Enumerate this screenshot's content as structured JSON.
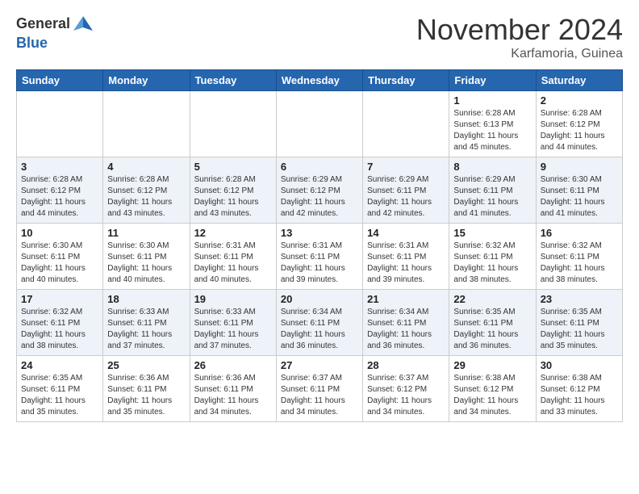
{
  "header": {
    "logo_general": "General",
    "logo_blue": "Blue",
    "month_title": "November 2024",
    "location": "Karfamoria, Guinea"
  },
  "days_of_week": [
    "Sunday",
    "Monday",
    "Tuesday",
    "Wednesday",
    "Thursday",
    "Friday",
    "Saturday"
  ],
  "weeks": [
    [
      {
        "day": "",
        "info": ""
      },
      {
        "day": "",
        "info": ""
      },
      {
        "day": "",
        "info": ""
      },
      {
        "day": "",
        "info": ""
      },
      {
        "day": "",
        "info": ""
      },
      {
        "day": "1",
        "info": "Sunrise: 6:28 AM\nSunset: 6:13 PM\nDaylight: 11 hours\nand 45 minutes."
      },
      {
        "day": "2",
        "info": "Sunrise: 6:28 AM\nSunset: 6:12 PM\nDaylight: 11 hours\nand 44 minutes."
      }
    ],
    [
      {
        "day": "3",
        "info": "Sunrise: 6:28 AM\nSunset: 6:12 PM\nDaylight: 11 hours\nand 44 minutes."
      },
      {
        "day": "4",
        "info": "Sunrise: 6:28 AM\nSunset: 6:12 PM\nDaylight: 11 hours\nand 43 minutes."
      },
      {
        "day": "5",
        "info": "Sunrise: 6:28 AM\nSunset: 6:12 PM\nDaylight: 11 hours\nand 43 minutes."
      },
      {
        "day": "6",
        "info": "Sunrise: 6:29 AM\nSunset: 6:12 PM\nDaylight: 11 hours\nand 42 minutes."
      },
      {
        "day": "7",
        "info": "Sunrise: 6:29 AM\nSunset: 6:11 PM\nDaylight: 11 hours\nand 42 minutes."
      },
      {
        "day": "8",
        "info": "Sunrise: 6:29 AM\nSunset: 6:11 PM\nDaylight: 11 hours\nand 41 minutes."
      },
      {
        "day": "9",
        "info": "Sunrise: 6:30 AM\nSunset: 6:11 PM\nDaylight: 11 hours\nand 41 minutes."
      }
    ],
    [
      {
        "day": "10",
        "info": "Sunrise: 6:30 AM\nSunset: 6:11 PM\nDaylight: 11 hours\nand 40 minutes."
      },
      {
        "day": "11",
        "info": "Sunrise: 6:30 AM\nSunset: 6:11 PM\nDaylight: 11 hours\nand 40 minutes."
      },
      {
        "day": "12",
        "info": "Sunrise: 6:31 AM\nSunset: 6:11 PM\nDaylight: 11 hours\nand 40 minutes."
      },
      {
        "day": "13",
        "info": "Sunrise: 6:31 AM\nSunset: 6:11 PM\nDaylight: 11 hours\nand 39 minutes."
      },
      {
        "day": "14",
        "info": "Sunrise: 6:31 AM\nSunset: 6:11 PM\nDaylight: 11 hours\nand 39 minutes."
      },
      {
        "day": "15",
        "info": "Sunrise: 6:32 AM\nSunset: 6:11 PM\nDaylight: 11 hours\nand 38 minutes."
      },
      {
        "day": "16",
        "info": "Sunrise: 6:32 AM\nSunset: 6:11 PM\nDaylight: 11 hours\nand 38 minutes."
      }
    ],
    [
      {
        "day": "17",
        "info": "Sunrise: 6:32 AM\nSunset: 6:11 PM\nDaylight: 11 hours\nand 38 minutes."
      },
      {
        "day": "18",
        "info": "Sunrise: 6:33 AM\nSunset: 6:11 PM\nDaylight: 11 hours\nand 37 minutes."
      },
      {
        "day": "19",
        "info": "Sunrise: 6:33 AM\nSunset: 6:11 PM\nDaylight: 11 hours\nand 37 minutes."
      },
      {
        "day": "20",
        "info": "Sunrise: 6:34 AM\nSunset: 6:11 PM\nDaylight: 11 hours\nand 36 minutes."
      },
      {
        "day": "21",
        "info": "Sunrise: 6:34 AM\nSunset: 6:11 PM\nDaylight: 11 hours\nand 36 minutes."
      },
      {
        "day": "22",
        "info": "Sunrise: 6:35 AM\nSunset: 6:11 PM\nDaylight: 11 hours\nand 36 minutes."
      },
      {
        "day": "23",
        "info": "Sunrise: 6:35 AM\nSunset: 6:11 PM\nDaylight: 11 hours\nand 35 minutes."
      }
    ],
    [
      {
        "day": "24",
        "info": "Sunrise: 6:35 AM\nSunset: 6:11 PM\nDaylight: 11 hours\nand 35 minutes."
      },
      {
        "day": "25",
        "info": "Sunrise: 6:36 AM\nSunset: 6:11 PM\nDaylight: 11 hours\nand 35 minutes."
      },
      {
        "day": "26",
        "info": "Sunrise: 6:36 AM\nSunset: 6:11 PM\nDaylight: 11 hours\nand 34 minutes."
      },
      {
        "day": "27",
        "info": "Sunrise: 6:37 AM\nSunset: 6:11 PM\nDaylight: 11 hours\nand 34 minutes."
      },
      {
        "day": "28",
        "info": "Sunrise: 6:37 AM\nSunset: 6:12 PM\nDaylight: 11 hours\nand 34 minutes."
      },
      {
        "day": "29",
        "info": "Sunrise: 6:38 AM\nSunset: 6:12 PM\nDaylight: 11 hours\nand 34 minutes."
      },
      {
        "day": "30",
        "info": "Sunrise: 6:38 AM\nSunset: 6:12 PM\nDaylight: 11 hours\nand 33 minutes."
      }
    ]
  ]
}
